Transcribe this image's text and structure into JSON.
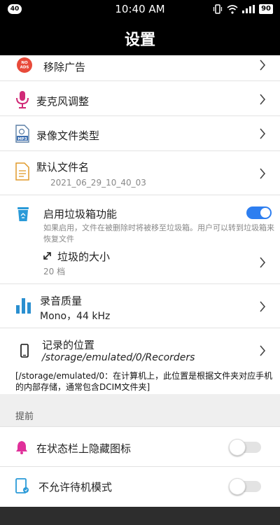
{
  "status_bar": {
    "notification_count": "40",
    "time": "10:40 AM",
    "battery": "90"
  },
  "header": {
    "title": "设置"
  },
  "settings": {
    "remove_ads": {
      "label": "移除广告",
      "icon_text": "NO ADS"
    },
    "mic_adjust": {
      "label": "麦克风调整"
    },
    "file_type": {
      "label": "录像文件类型",
      "icon_text": "MP3"
    },
    "default_name": {
      "label": "默认文件名",
      "value": "2021_06_29_10_40_03"
    },
    "recycle_bin": {
      "label": "启用垃圾箱功能",
      "description": "如果启用，文件在被删除时将被移至垃圾箱。用户可以转到垃圾箱来恢复文件",
      "enabled": true
    },
    "bin_size": {
      "label": "垃圾的大小",
      "value": "20 档"
    },
    "quality": {
      "label": "录音质量",
      "value": "Mono，44 kHz"
    },
    "location": {
      "label": "记录的位置",
      "value": "/storage/emulated/0/Recorders",
      "note": "[/storage/emulated/0：在计算机上，此位置是根据文件夹对应手机的内部存储，通常包含DCIM文件夹]"
    }
  },
  "advanced": {
    "section_title": "提前",
    "hide_icon": {
      "label": "在状态栏上隐藏图标",
      "enabled": false
    },
    "no_standby": {
      "label": "不允许待机模式",
      "enabled": false
    }
  },
  "colors": {
    "accent": "#2d7ef0",
    "header_bg": "#000000",
    "mic_icon": "#d02a77",
    "bell_icon": "#e0309a",
    "file_icon": "#e09a2a",
    "trash_icon": "#2a9ad8"
  }
}
